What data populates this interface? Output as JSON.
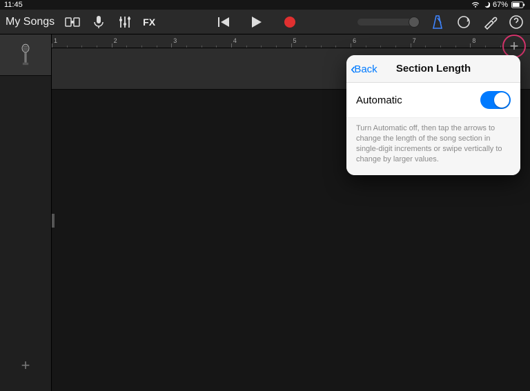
{
  "statusbar": {
    "time": "11:45",
    "battery": "67%"
  },
  "toolbar": {
    "my_songs": "My Songs",
    "fx": "FX"
  },
  "ruler": {
    "marks": [
      1,
      2,
      3,
      4,
      5,
      6,
      7,
      8
    ]
  },
  "popover": {
    "back": "Back",
    "title": "Section Length",
    "automatic": "Automatic",
    "help": "Turn Automatic off, then tap the arrows to change the length of the song section in single-digit increments or swipe vertically to change by larger values."
  }
}
